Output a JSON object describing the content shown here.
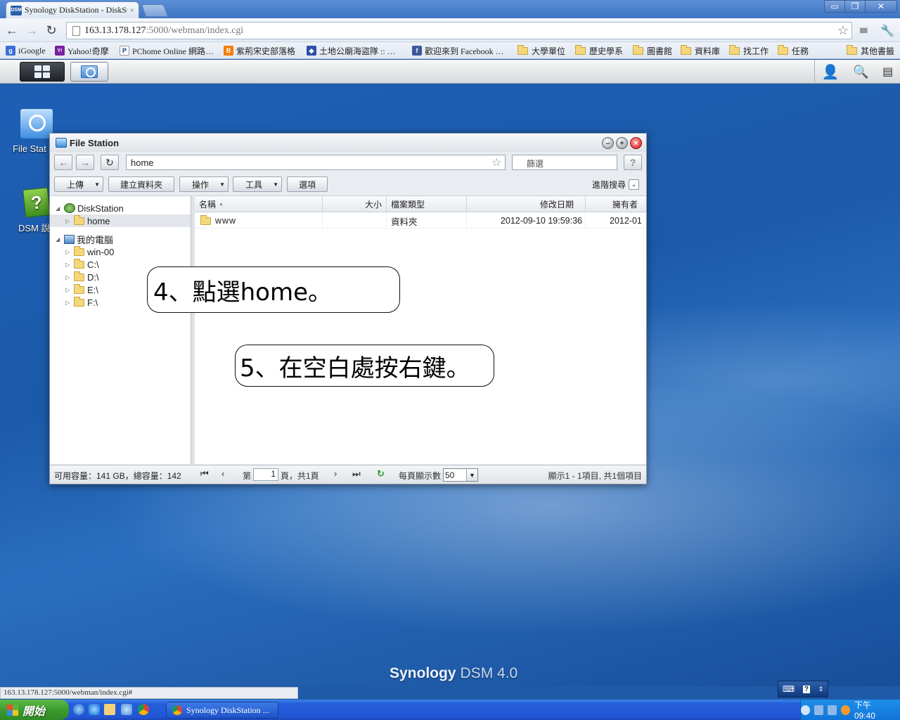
{
  "browser": {
    "tab_title": "Synology DiskStation - DiskSt",
    "tab_close": "×",
    "favicon_text": "DSM",
    "window_controls": {
      "minimize": "▭",
      "restore": "❐",
      "close": "✕"
    },
    "nav": {
      "back": "←",
      "forward": "→",
      "reload": "↻"
    },
    "url_host": "163.13.178.127",
    "url_path": ":5000/webman/index.cgi",
    "star": "☆",
    "right_icons": {
      "stats": "▮▮▮",
      "wrench": "🔧"
    }
  },
  "bookmarks": [
    {
      "label": "iGoogle",
      "icon": "g",
      "color": "#3b6fd6"
    },
    {
      "label": "Yahoo!奇摩",
      "icon": "Y!",
      "color": "#7b1fa2"
    },
    {
      "label": "PChome Online 網路…",
      "icon": "P",
      "color": "#1a3e8c"
    },
    {
      "label": "紫荊宋史部落格",
      "icon": "B",
      "color": "#f57c00"
    },
    {
      "label": "土地公廟海盜隊 :: …",
      "icon": "◆",
      "color": "#2c4fa8"
    },
    {
      "label": "歡迎來到 Facebook …",
      "icon": "f",
      "color": "#3b5998"
    },
    {
      "label": "大學單位",
      "icon": "folder"
    },
    {
      "label": "歷史學系",
      "icon": "folder"
    },
    {
      "label": "圖書館",
      "icon": "folder"
    },
    {
      "label": "資料庫",
      "icon": "folder"
    },
    {
      "label": "找工作",
      "icon": "folder"
    },
    {
      "label": "任務",
      "icon": "folder"
    }
  ],
  "other_bookmarks": "其他書籤",
  "dsm": {
    "top_right_icons": [
      "user-icon",
      "search-icon",
      "widgets-icon"
    ],
    "desktop_icons": [
      {
        "label": "File Stat",
        "kind": "file-station"
      },
      {
        "label": "DSM 說",
        "kind": "help"
      }
    ],
    "brand_main": "Synology",
    "brand_version": "DSM 4.0"
  },
  "file_station": {
    "title": "File Station",
    "path": "home",
    "filter_placeholder": "篩選",
    "help": "?",
    "toolbar": {
      "upload": "上傳",
      "create_folder": "建立資料夾",
      "action": "操作",
      "tools": "工具",
      "options": "選項",
      "advanced_search": "進階搜尋"
    },
    "tree": {
      "root": "DiskStation",
      "root_children": [
        "home"
      ],
      "computer": "我的電腦",
      "computer_children": [
        "win-00",
        "C:\\",
        "D:\\",
        "E:\\",
        "F:\\"
      ]
    },
    "columns": {
      "name": "名稱",
      "sort": "▲",
      "size": "大小",
      "type": "檔案類型",
      "modified": "修改日期",
      "owner": "擁有者"
    },
    "rows": [
      {
        "name": "www",
        "size": "",
        "type": "資料夾",
        "modified": "2012-09-10 19:59:36",
        "owner": "2012-01"
      }
    ],
    "status": {
      "capacity": "可用容量：141 GB，總容量：142",
      "page_prefix": "第",
      "page_value": "1",
      "page_suffix": "頁，共1頁",
      "per_page_label": "每頁顯示數",
      "per_page_value": "50",
      "summary": "顯示1 - 1項目, 共1個項目"
    }
  },
  "callouts": {
    "step4": "4、點選home。",
    "step5": "5、在空白處按右鍵。"
  },
  "status_url": "163.13.178.127:5000/webman/index.cgi#",
  "windows": {
    "start": "開始",
    "task_label": "Synology DiskStation ...",
    "clock": "下午 09:40"
  }
}
